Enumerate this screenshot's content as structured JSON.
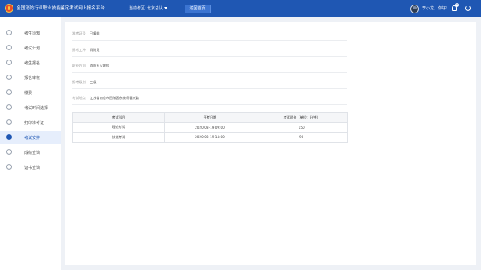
{
  "header": {
    "app_title": "全国消防行业职业技能鉴定考试网上报名平台",
    "current_exam_label": "当前考区:",
    "current_exam_value": "北京总队",
    "back_button": "返回首页",
    "username": "李小龙，你好!",
    "notification_count": "9",
    "brand_color": "#1f57b3"
  },
  "sidebar": {
    "items": [
      {
        "label": "考生须知",
        "icon": "info-icon"
      },
      {
        "label": "考试计划",
        "icon": "calendar-icon"
      },
      {
        "label": "考生报名",
        "icon": "user-add-icon"
      },
      {
        "label": "报名审核",
        "icon": "audit-icon"
      },
      {
        "label": "缴费",
        "icon": "payment-icon"
      },
      {
        "label": "考试时间选择",
        "icon": "clock-icon"
      },
      {
        "label": "打印准考证",
        "icon": "print-icon"
      },
      {
        "label": "考试安排",
        "icon": "arrange-icon",
        "active": true
      },
      {
        "label": "成绩查询",
        "icon": "score-icon"
      },
      {
        "label": "证书查询",
        "icon": "certificate-icon"
      }
    ]
  },
  "info": [
    {
      "label": "准考证号:",
      "value": "已编排"
    },
    {
      "label": "报考工种:",
      "value": "消防员"
    },
    {
      "label": "职业方向:",
      "value": "消防灭火救援"
    },
    {
      "label": "报考级别:",
      "value": "三级"
    },
    {
      "label": "考试地点:",
      "value": "江苏省南京市西陵区东陵桥福兴路"
    }
  ],
  "table": {
    "headers": [
      "考试科目",
      "开考日期",
      "考试时长（单位：分钟）"
    ],
    "rows": [
      [
        "理论考试",
        "2020-08-19  09:00",
        "150"
      ],
      [
        "技能考试",
        "2020-08-19  14:00",
        "90"
      ]
    ]
  }
}
